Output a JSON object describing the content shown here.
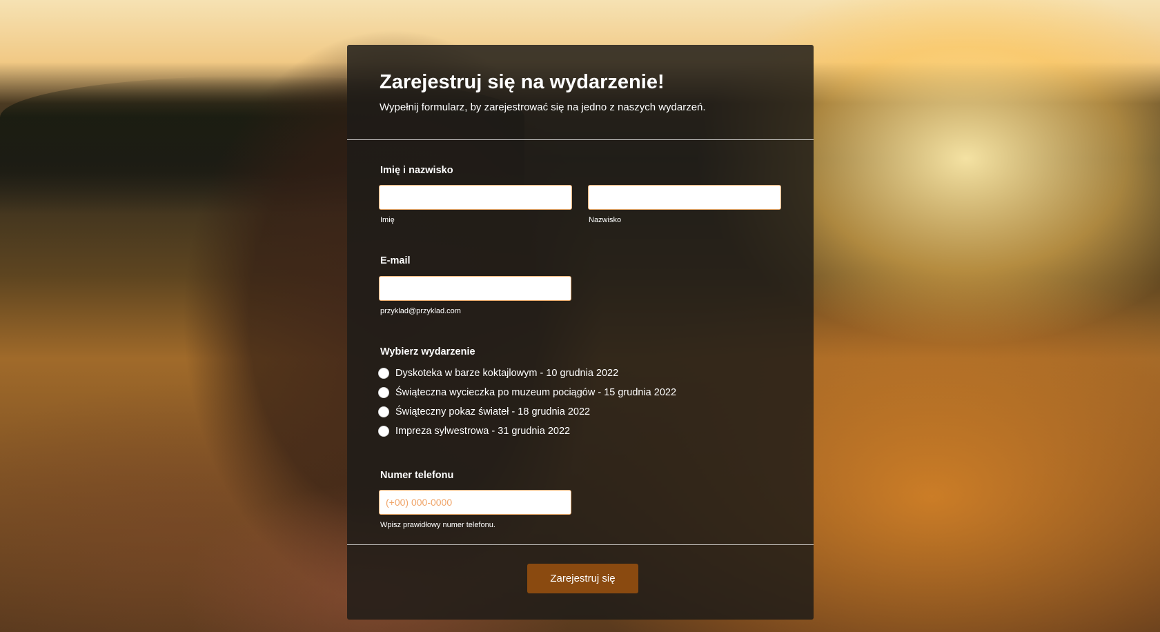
{
  "form": {
    "title": "Zarejestruj się na wydarzenie!",
    "subtitle": "Wypełnij formularz, by zarejestrować się na jedno z naszych wydarzeń.",
    "name": {
      "label": "Imię i nazwisko",
      "first_sublabel": "Imię",
      "first_value": "",
      "last_sublabel": "Nazwisko",
      "last_value": ""
    },
    "email": {
      "label": "E-mail",
      "value": "",
      "sublabel": "przyklad@przyklad.com"
    },
    "event": {
      "label": "Wybierz wydarzenie",
      "options": [
        "Dyskoteka w barze koktajlowym - 10 grudnia 2022",
        "Świąteczna wycieczka po muzeum pociągów - 15 grudnia 2022",
        "Świąteczny pokaz świateł - 18 grudnia 2022",
        "Impreza sylwestrowa - 31 grudnia 2022"
      ]
    },
    "phone": {
      "label": "Numer telefonu",
      "placeholder": "(+00) 000-0000",
      "value": "",
      "sublabel": "Wpisz prawidłowy numer telefonu."
    },
    "submit_label": "Zarejestruj się"
  },
  "colors": {
    "card_background": "#1e1b18",
    "button": "#8a4a10",
    "input_border": "#f0b070",
    "placeholder": "#f0a468"
  }
}
